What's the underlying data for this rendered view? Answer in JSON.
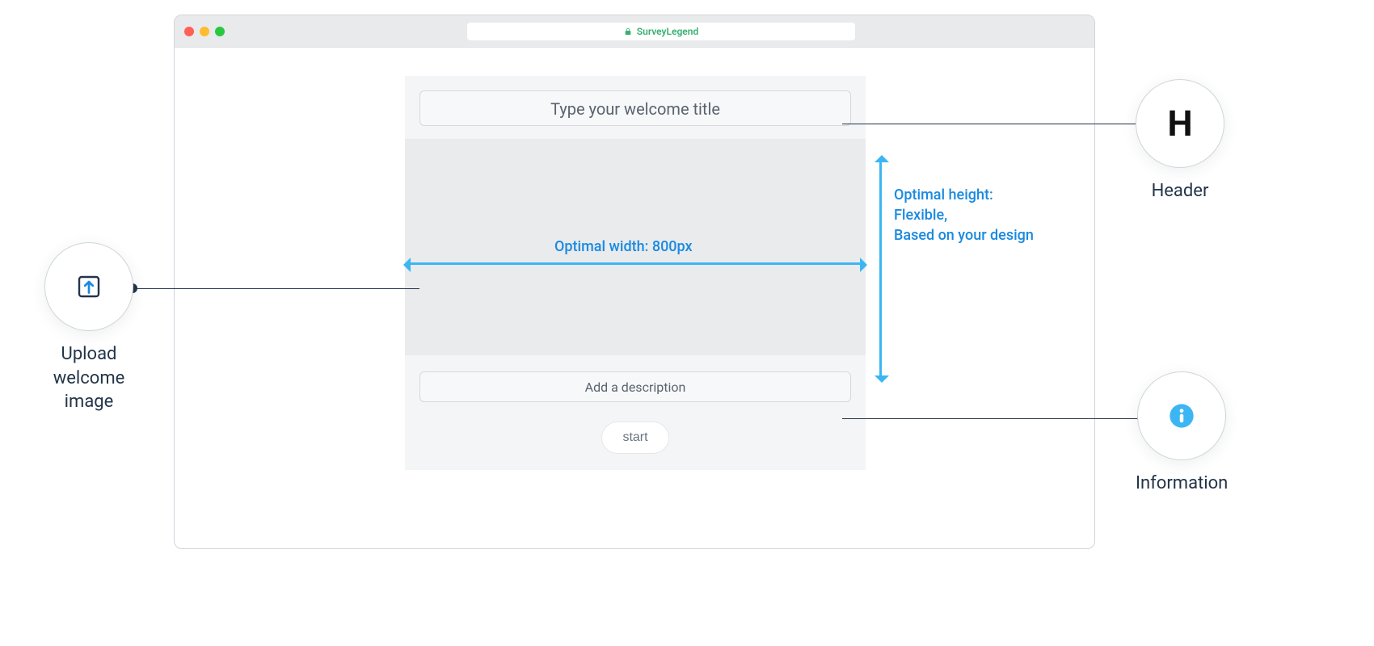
{
  "browser": {
    "site_name": "SurveyLegend",
    "secure": true
  },
  "editor": {
    "title_placeholder": "Type your welcome title",
    "description_placeholder": "Add a description",
    "start_button_label": "start"
  },
  "dimensions": {
    "width_label": "Optimal width:  800px",
    "height_label": "Optimal height:\nFlexible,\nBased on your design"
  },
  "callouts": {
    "upload": {
      "label": "Upload\nwelcome\nimage",
      "icon": "upload-icon"
    },
    "header": {
      "label": "Header",
      "glyph": "H"
    },
    "info": {
      "label": "Information",
      "icon": "info-icon"
    }
  },
  "colors": {
    "accent_blue": "#3cb6f3",
    "brand_green": "#37b06f",
    "ink": "#233448"
  }
}
